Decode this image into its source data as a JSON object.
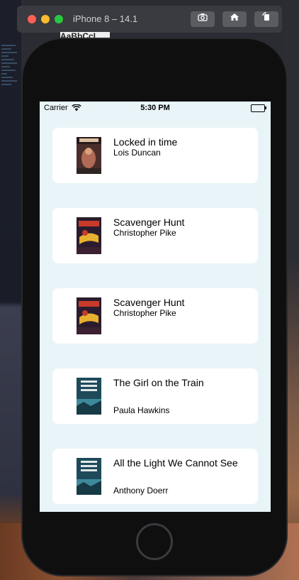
{
  "simulator": {
    "title": "iPhone 8 – 14.1",
    "behind_text": "AaBbCcI",
    "buttons": [
      {
        "icon": "camera-icon",
        "glyph": "📷"
      },
      {
        "icon": "home-icon",
        "glyph": "⌂"
      },
      {
        "icon": "rotate-icon",
        "glyph": "↺"
      }
    ]
  },
  "status_bar": {
    "carrier": "Carrier",
    "time": "5:30 PM"
  },
  "books": [
    {
      "title": "Locked in time",
      "author": "Lois Duncan",
      "cover": "locked-in-time-cover",
      "cover_colors": [
        "#4a2e2a",
        "#b06a55",
        "#d9c2a0"
      ]
    },
    {
      "title": "Scavenger Hunt",
      "author": "Christopher Pike",
      "cover": "scavenger-hunt-cover",
      "cover_colors": [
        "#2a1c2e",
        "#c83a2a",
        "#e8b030"
      ]
    },
    {
      "title": "Scavenger Hunt",
      "author": "Christopher Pike",
      "cover": "scavenger-hunt-cover",
      "cover_colors": [
        "#2a1c2e",
        "#c83a2a",
        "#e8b030"
      ]
    },
    {
      "title": "The Girl on the Train",
      "author": "Paula Hawkins",
      "cover": "all-the-light-cover",
      "cover_colors": [
        "#1e4a5a",
        "#3e8a9a",
        "#e0e8e8"
      ]
    },
    {
      "title": "All the Light We Cannot See",
      "author": "Anthony Doerr",
      "cover": "all-the-light-cover",
      "cover_colors": [
        "#1e4a5a",
        "#3e8a9a",
        "#e0e8e8"
      ]
    }
  ]
}
